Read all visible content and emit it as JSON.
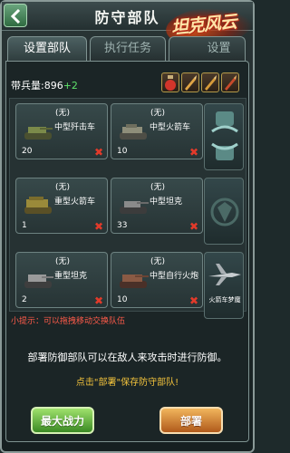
{
  "header": {
    "title": "防守部队",
    "logo_text": "坦克风云"
  },
  "tabs": [
    {
      "label": "设置部队",
      "active": true
    },
    {
      "label": "执行任务",
      "active": false
    },
    {
      "label": "设置",
      "active": false
    }
  ],
  "capacity": {
    "label": "带兵量:",
    "value": "896",
    "bonus": "+2"
  },
  "units": [
    {
      "slot": "(无)",
      "name": "中型歼击车",
      "count": "20"
    },
    {
      "slot": "(无)",
      "name": "中型火箭车",
      "count": "10"
    },
    {
      "slot": "(无)",
      "name": "重型火箭车",
      "count": "1"
    },
    {
      "slot": "(无)",
      "name": "中型坦克",
      "count": "33"
    },
    {
      "slot": "(无)",
      "name": "重型坦克",
      "count": "2"
    },
    {
      "slot": "(无)",
      "name": "中型自行火炮",
      "count": "10"
    }
  ],
  "side": {
    "caption": "火箭车梦魔"
  },
  "tip": "小提示：可以拖拽移动交换队伍",
  "description": "部署防御部队可以在敌人来攻击时进行防御。",
  "hint": "点击\"部署\"保存防守部队!",
  "buttons": {
    "max_power": "最大战力",
    "deploy": "部署"
  },
  "icons": [
    "back-arrow-icon",
    "potion-icon",
    "bullet-icon",
    "bullet-icon",
    "bullet-icon",
    "missile-icon",
    "tank-icon",
    "remove-icon",
    "swap-icon",
    "shield-emblem-icon",
    "jet-icon"
  ],
  "colors": {
    "accent_green": "#3b8a24",
    "accent_orange": "#b05a1b",
    "warning_red": "#ff5b4a",
    "hint_yellow": "#f2c23c"
  }
}
